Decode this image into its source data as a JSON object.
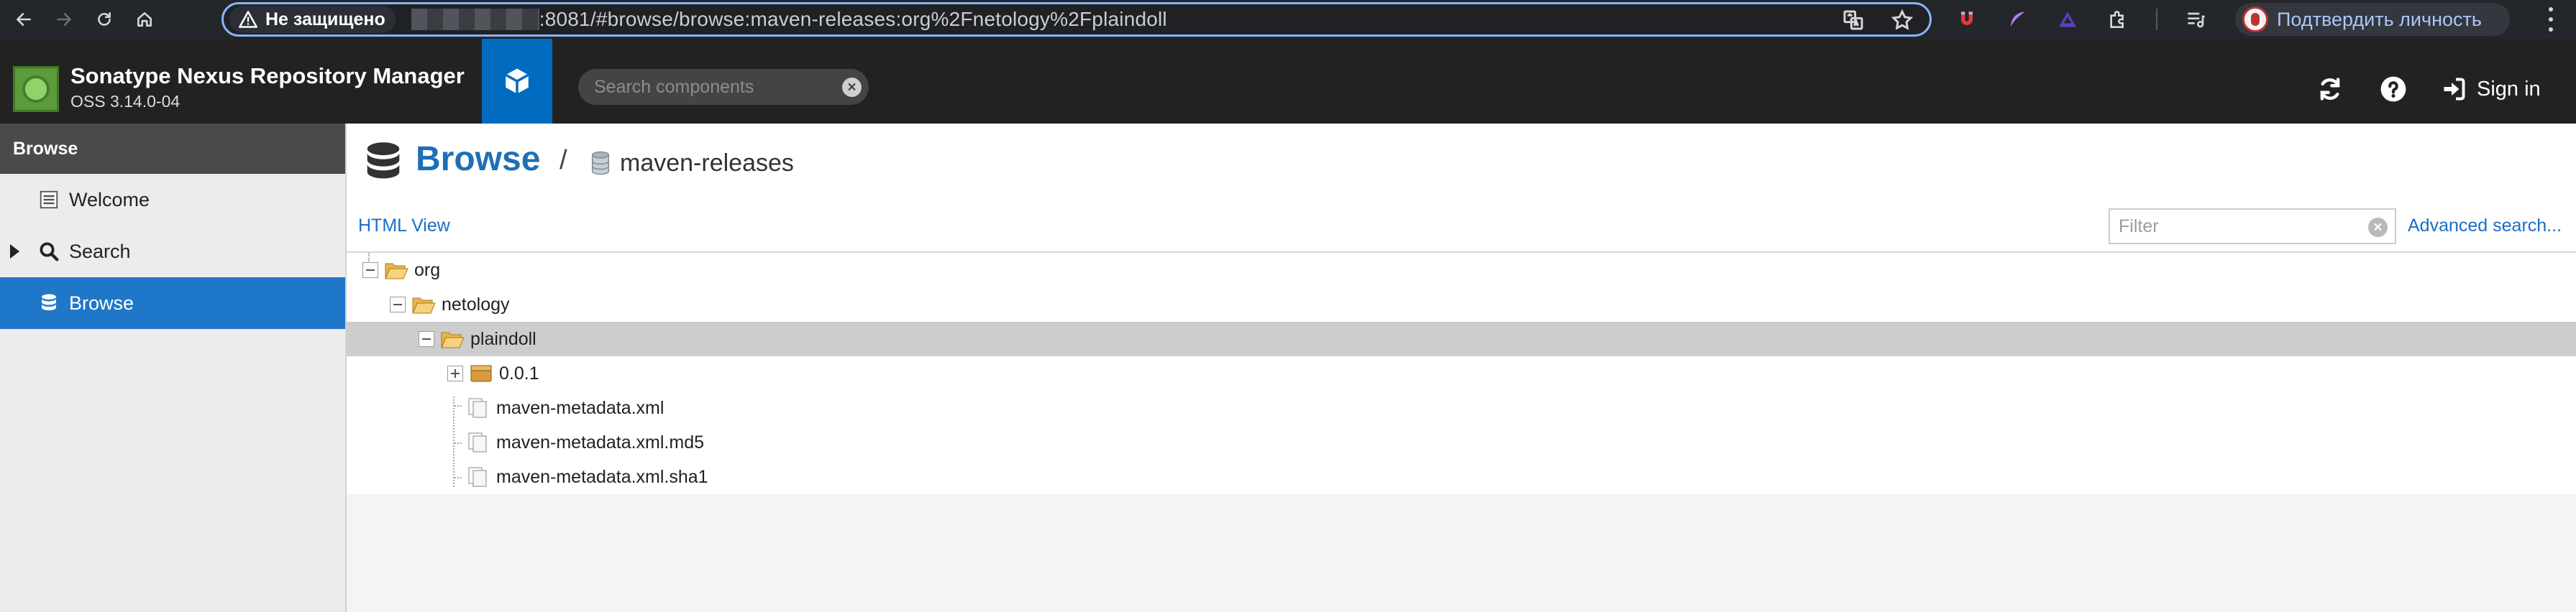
{
  "browser": {
    "security_label": "Не защищено",
    "url": ":8081/#browse/browse:maven-releases:org%2Fnetology%2Fplaindoll",
    "profile_label": "Подтвердить личность",
    "icons": [
      "back-icon",
      "forward-icon",
      "reload-icon",
      "home-icon",
      "warning-icon",
      "translate-icon",
      "star-icon",
      "extensions-icon",
      "media-icon",
      "kebab-icon"
    ]
  },
  "app": {
    "title": "Sonatype Nexus Repository Manager",
    "version": "OSS 3.14.0-04",
    "search_placeholder": "Search components",
    "sign_in_label": "Sign in",
    "brand_color": "#006bbf"
  },
  "sidebar": {
    "header": "Browse",
    "items": [
      {
        "label": "Welcome",
        "icon": "list-icon",
        "active": false
      },
      {
        "label": "Search",
        "icon": "search-icon",
        "active": false,
        "expandable": true
      },
      {
        "label": "Browse",
        "icon": "database-icon",
        "active": true
      }
    ]
  },
  "main": {
    "title": "Browse",
    "separator": "/",
    "repository": "maven-releases",
    "html_view_label": "HTML View",
    "filter_placeholder": "Filter",
    "advanced_search_label": "Advanced search...",
    "tree": [
      {
        "label": "org",
        "icon": "folder-open-icon",
        "depth": 0,
        "expanded": true
      },
      {
        "label": "netology",
        "icon": "folder-open-icon",
        "depth": 1,
        "expanded": true
      },
      {
        "label": "plaindoll",
        "icon": "folder-open-icon",
        "depth": 2,
        "expanded": true,
        "selected": true
      },
      {
        "label": "0.0.1",
        "icon": "component-icon",
        "depth": 3,
        "expanded": false
      },
      {
        "label": "maven-metadata.xml",
        "icon": "file-icon",
        "depth": 3
      },
      {
        "label": "maven-metadata.xml.md5",
        "icon": "file-icon",
        "depth": 3
      },
      {
        "label": "maven-metadata.xml.sha1",
        "icon": "file-icon",
        "depth": 3
      }
    ]
  }
}
